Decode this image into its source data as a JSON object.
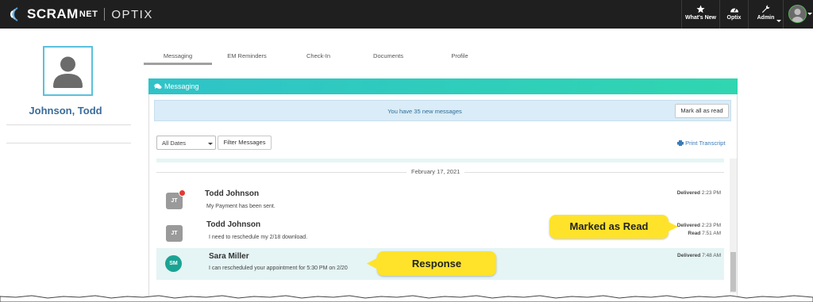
{
  "app": {
    "brand": "SCRAM",
    "brand_suffix": "NET",
    "product": "OPTIX"
  },
  "nav": {
    "whats_new": "What's New",
    "optix": "Optix",
    "admin": "Admin"
  },
  "profile": {
    "name": "Johnson, Todd"
  },
  "tabs": [
    "Messaging",
    "EM Reminders",
    "Check-In",
    "Documents",
    "Profile"
  ],
  "panel": {
    "title": "Messaging"
  },
  "alert": {
    "text": "You have 35 new messages",
    "button": "Mark all as read"
  },
  "filters": {
    "date_selected": "All Dates",
    "filter_button": "Filter Messages",
    "print": "Print Transcript"
  },
  "date_divider": "February 17, 2021",
  "messages": [
    {
      "initials": "JT",
      "sender": "Todd Johnson",
      "text": "My Payment has been sent.",
      "delivered_label": "Delivered",
      "delivered_time": "2:23 PM"
    },
    {
      "initials": "JT",
      "sender": "Todd Johnson",
      "text": "I need to reschedule my 2/18 download.",
      "delivered_label": "Delivered",
      "delivered_time": "2:23 PM",
      "read_label": "Read",
      "read_time": "7:51 AM"
    },
    {
      "initials": "SM",
      "sender": "Sara Miller",
      "text": "I can rescheduled your appointment for 5:30 PM on 2/20",
      "delivered_label": "Delivered",
      "delivered_time": "7:48 AM"
    }
  ],
  "callouts": {
    "marked_as_read": "Marked as Read",
    "response": "Response"
  },
  "colors": {
    "topbar": "#1f1f1f",
    "accent_teal": "#2fc3c8",
    "callout_yellow": "#ffe32a",
    "name_blue": "#3a6b9a"
  }
}
